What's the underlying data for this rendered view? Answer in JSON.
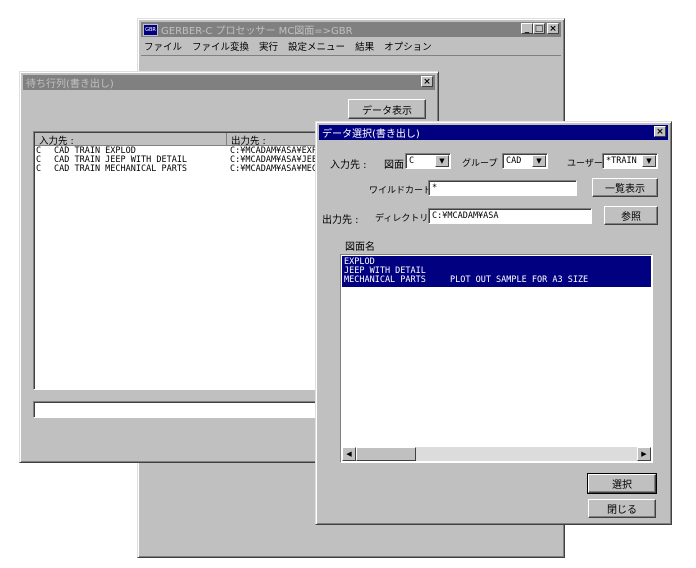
{
  "main_window": {
    "title": "GERBER-C プロセッサー MC図面=>GBR",
    "menu": [
      "ファイル",
      "ファイル変換",
      "実行",
      "設定メニュー",
      "結果",
      "オプション"
    ]
  },
  "queue_window": {
    "title": "待ち行列(書き出し)",
    "data_button": "データ表示",
    "col_input": "入力先 :",
    "col_output": "出力先 :",
    "rows": [
      {
        "type": "C",
        "name": "CAD TRAIN EXPLOD",
        "output": "C:¥MCADAM¥ASA¥EXPL"
      },
      {
        "type": "C",
        "name": "CAD TRAIN JEEP WITH DETAIL",
        "output": "C:¥MCADAM¥ASA¥JEEP"
      },
      {
        "type": "C",
        "name": "CAD TRAIN MECHANICAL PARTS",
        "output": "C:¥MCADAM¥ASA¥MECH"
      }
    ]
  },
  "select_dialog": {
    "title": "データ選択(書き出し)",
    "input_label": "入力先 :",
    "drawing_label": "図面",
    "drawing_value": "C",
    "group_label": "グループ",
    "group_value": "CAD",
    "user_label": "ユーザー",
    "user_value": "*TRAIN",
    "wildcard_label": "ワイルドカード",
    "wildcard_value": "*",
    "list_button": "一覧表示",
    "output_label": "出力先 :",
    "directory_label": "ディレクトリー",
    "directory_value": "C:¥MCADAM¥ASA",
    "browse_button": "参照",
    "drawing_name_label": "図面名",
    "items": [
      {
        "name": "EXPLOD",
        "comment": ""
      },
      {
        "name": "JEEP WITH DETAIL",
        "comment": ""
      },
      {
        "name": "MECHANICAL PARTS",
        "comment": "PLOT OUT SAMPLE FOR A3 SIZE"
      }
    ],
    "select_button": "選択",
    "close_button": "閉じる"
  }
}
